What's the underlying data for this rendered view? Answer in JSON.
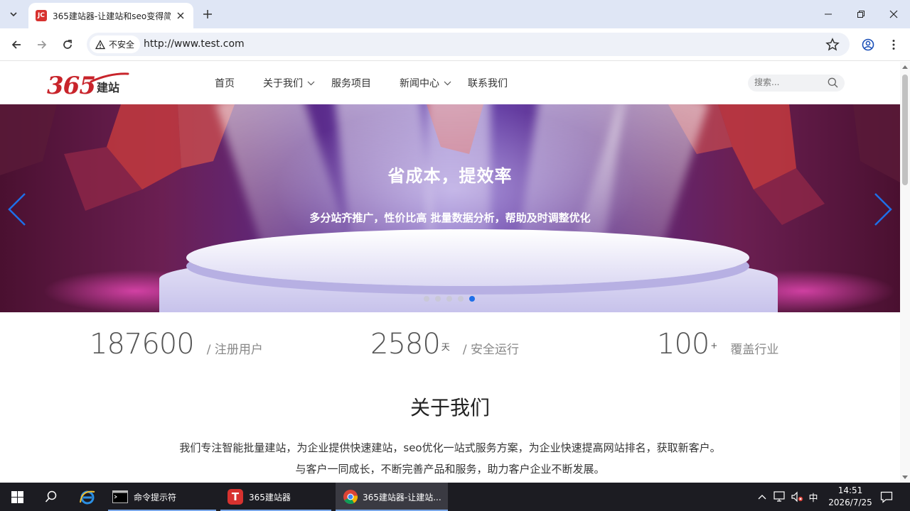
{
  "browser": {
    "tab_title": "365建站器-让建站和seo变得简",
    "tab_favicon_text": "JC",
    "security_label": "不安全",
    "url": "http://www.test.com"
  },
  "site": {
    "logo_number": "365",
    "logo_text": "建站",
    "nav": [
      "首页",
      "关于我们",
      "服务项目",
      "新闻中心",
      "联系我们"
    ],
    "search_placeholder": "搜索..."
  },
  "banner": {
    "title": "省成本，提效率",
    "subtitle": "多分站齐推广，性价比高 批量数据分析，帮助及时调整优化",
    "slide_count": 5,
    "active_slide": 5
  },
  "stats": [
    {
      "number": "187600",
      "sup": "",
      "label": "/ 注册用户"
    },
    {
      "number": "2580",
      "sup": "天",
      "label": "/ 安全运行"
    },
    {
      "number": "100",
      "sup": "+",
      "label": "覆盖行业"
    }
  ],
  "about": {
    "title": "关于我们",
    "line1": "我们专注智能批量建站，为企业提供快速建站，seo优化一站式服务方案，为企业快速提高网站排名，获取新客户。",
    "line2": "与客户一同成长，不断完善产品和服务，助力客户企业不断发展。"
  },
  "taskbar": {
    "apps": [
      "命令提示符",
      "365建站器",
      "365建站器-让建站..."
    ],
    "tray_ime": "中",
    "time": "14:51",
    "date": "2026/7/25"
  },
  "colors": {
    "brand_red": "#c8242b",
    "accent_blue": "#1e6fe8",
    "taskbar": "#1c1c22"
  }
}
